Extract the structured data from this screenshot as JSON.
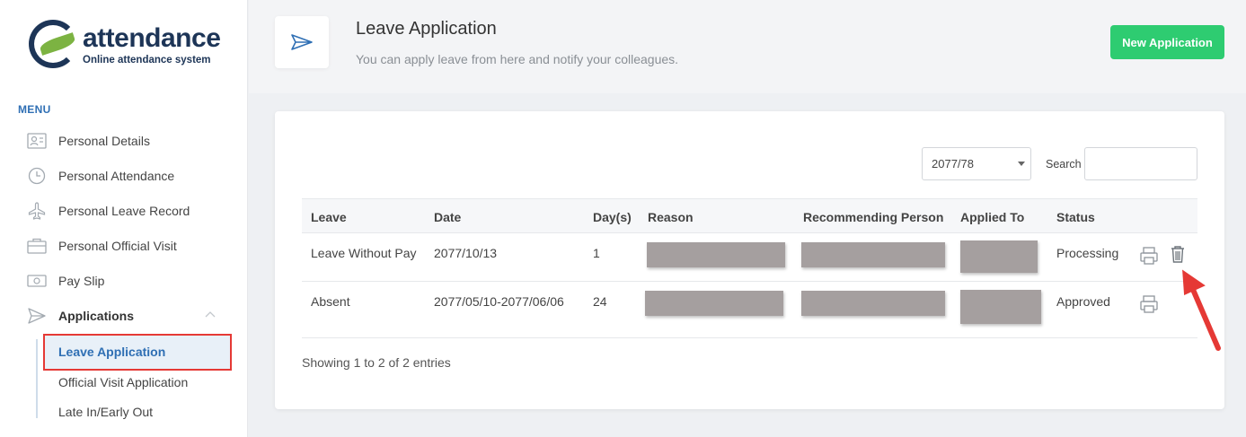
{
  "brand": {
    "title": "attendance",
    "subtitle": "Online attendance system"
  },
  "menu": {
    "label": "MENU",
    "items": [
      {
        "label": "Personal Details",
        "icon": "id-card-icon"
      },
      {
        "label": "Personal Attendance",
        "icon": "clock-icon"
      },
      {
        "label": "Personal Leave Record",
        "icon": "plane-icon"
      },
      {
        "label": "Personal Official Visit",
        "icon": "briefcase-icon"
      },
      {
        "label": "Pay Slip",
        "icon": "money-icon"
      },
      {
        "label": "Applications",
        "icon": "paper-plane-icon"
      }
    ],
    "submenu": [
      {
        "label": "Leave Application",
        "active": true
      },
      {
        "label": "Official Visit Application"
      },
      {
        "label": "Late In/Early Out"
      }
    ]
  },
  "header": {
    "title": "Leave Application",
    "subtitle": "You can apply leave from here and notify your colleagues.",
    "new_button": "New Application"
  },
  "filters": {
    "year": "2077/78",
    "search_label": "Search",
    "search_value": ""
  },
  "table": {
    "columns": [
      "Leave",
      "Date",
      "Day(s)",
      "Reason",
      "Recommending Person",
      "Applied To",
      "Status"
    ],
    "rows": [
      {
        "leave": "Leave Without Pay",
        "date": "2077/10/13",
        "days": "1",
        "status": "Processing",
        "actions": [
          "print-icon",
          "trash-icon"
        ]
      },
      {
        "leave": "Absent",
        "date": "2077/05/10-2077/06/06",
        "days": "24",
        "status": "Approved",
        "actions": [
          "print-icon"
        ]
      }
    ]
  },
  "footer": {
    "showing": "Showing 1 to 2 of 2 entries"
  },
  "colors": {
    "accent_blue": "#2f6fb4",
    "green_button": "#2ecc71",
    "annotation_red": "#e53935"
  }
}
